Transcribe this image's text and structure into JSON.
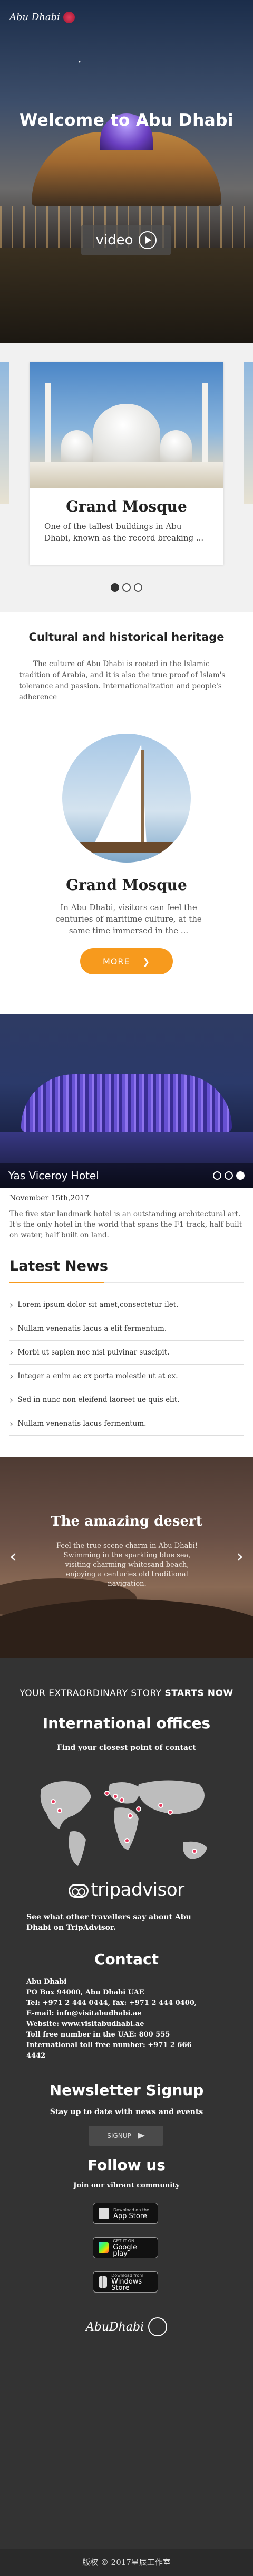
{
  "header": {
    "logo_text": "Abu Dhabi",
    "marker": "•",
    "hero_title": "Welcome to Abu Dhabi",
    "video_label": "video"
  },
  "carousel": {
    "card_title": "Grand Mosque",
    "card_text": "One of the tallest buildings in Abu Dhabi, known as the record breaking ...",
    "pages": 3,
    "active_page": 1
  },
  "heritage": {
    "title": "Cultural and historical heritage",
    "text": "The culture of Abu Dhabi is rooted in the Islamic tradition of Arabia, and it is also the true proof of Islam's tolerance and passion. Internationalization and people's adherence",
    "feature_title": "Grand Mosque",
    "feature_text": "In Abu Dhabi, visitors can feel the centuries of maritime culture, at the same time immersed in the ...",
    "more_label": "MORE",
    "more_icon": "chevron-right-icon"
  },
  "hotel": {
    "name": "Yas Viceroy Hotel",
    "date": "November 15th,2017",
    "text": "The five star landmark hotel is an outstanding architectural art. It's the only hotel in the world that spans the F1 track, half built on water, half built on land.",
    "pages": 3,
    "active_page": 3
  },
  "latest_news": {
    "title": "Latest News",
    "items": [
      "Lorem ipsum dolor sit amet,consectetur ilet.",
      "Nullam venenatis lacus a elit fermentum.",
      "Morbi ut sapien nec nisl pulvinar suscipit.",
      "Integer a enim ac ex porta molestie ut at ex.",
      "Sed in nunc non eleifend laoreet ue quis elit.",
      "Nullam venenatis lacus fermentum."
    ]
  },
  "desert": {
    "title": "The amazing desert",
    "text": "Feel the true scene charm in Abu Dhabi! Swimming in the sparkling blue sea, visiting charming whitesand beach, enjoying a centuries old traditional navigation.",
    "prev_icon": "chevron-left-icon",
    "next_icon": "chevron-right-icon"
  },
  "offices": {
    "story_prefix": "YOUR EXTRAORDINARY STORY",
    "story_emphasis": "STARTS NOW",
    "title": "International offices",
    "subtitle": "Find your closest point of contact",
    "tripadvisor_label": "tripadvisor",
    "tripadvisor_text": "See what other travellers say about Abu Dhabi on TripAdvisor."
  },
  "contact": {
    "title": "Contact",
    "lines": [
      "Abu Dhabi",
      "PO Box 94000, Abu Dhabi UAE",
      "Tel: +971 2 444 0444, fax: +971 2 444 0400,",
      "E-mail: info@visitabudhabi.ae",
      "Website: www.visitabudhabi.ae"
    ],
    "toll_lines": [
      "Toll free number in the UAE: 800 555",
      "International toll free number: +971 2 666",
      "4442"
    ]
  },
  "newsletter": {
    "title": "Newsletter Signup",
    "subtitle": "Stay up to date with news and events",
    "signup_label": "SIGNUP"
  },
  "follow": {
    "title": "Follow us",
    "subtitle": "Join our vibrant community",
    "stores": [
      {
        "top": "Download on the",
        "name": "App Store",
        "icon": "apple-icon"
      },
      {
        "top": "GET IT ON",
        "name": "Google play",
        "icon": "google-play-icon"
      },
      {
        "top": "Download from",
        "name": "Windows Store",
        "icon": "windows-icon"
      }
    ],
    "footer_logo_text": "AbuDhabi"
  },
  "footer": {
    "copyright": "版权 © 2017星辰工作室"
  },
  "colors": {
    "accent": "#f79a1d",
    "dark": "#333333",
    "pin": "#e7365a"
  }
}
